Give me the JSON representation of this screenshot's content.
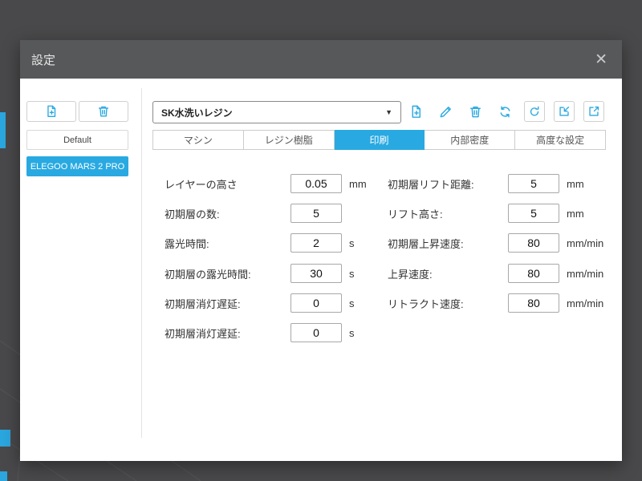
{
  "dialog": {
    "title": "設定",
    "close_glyph": "✕"
  },
  "sidebar": {
    "profiles": [
      {
        "label": "Default"
      },
      {
        "label": "ELEGOO MARS 2 PRO"
      }
    ]
  },
  "preset": {
    "selected": "SK水洗いレジン",
    "arrow_glyph": "▼"
  },
  "tabs": [
    {
      "label": "マシン"
    },
    {
      "label": "レジン樹脂"
    },
    {
      "label": "印刷"
    },
    {
      "label": "内部密度"
    },
    {
      "label": "高度な設定"
    }
  ],
  "form": {
    "left": [
      {
        "label": "レイヤーの高さ",
        "value": "0.05",
        "unit": "mm"
      },
      {
        "label": "初期層の数:",
        "value": "5",
        "unit": ""
      },
      {
        "label": "露光時間:",
        "value": "2",
        "unit": "s"
      },
      {
        "label": "初期層の露光時間:",
        "value": "30",
        "unit": "s"
      },
      {
        "label": "初期層消灯遅延:",
        "value": "0",
        "unit": "s"
      },
      {
        "label": "初期層消灯遅延:",
        "value": "0",
        "unit": "s"
      }
    ],
    "right": [
      {
        "label": "初期層リフト距離:",
        "value": "5",
        "unit": "mm"
      },
      {
        "label": "リフト高さ:",
        "value": "5",
        "unit": "mm"
      },
      {
        "label": "初期層上昇速度:",
        "value": "80",
        "unit": "mm/min"
      },
      {
        "label": "上昇速度:",
        "value": "80",
        "unit": "mm/min"
      },
      {
        "label": "リトラクト速度:",
        "value": "80",
        "unit": "mm/min"
      }
    ]
  },
  "colors": {
    "accent": "#29a9e1",
    "header_bg": "#57585a",
    "app_bg": "#49494b"
  }
}
